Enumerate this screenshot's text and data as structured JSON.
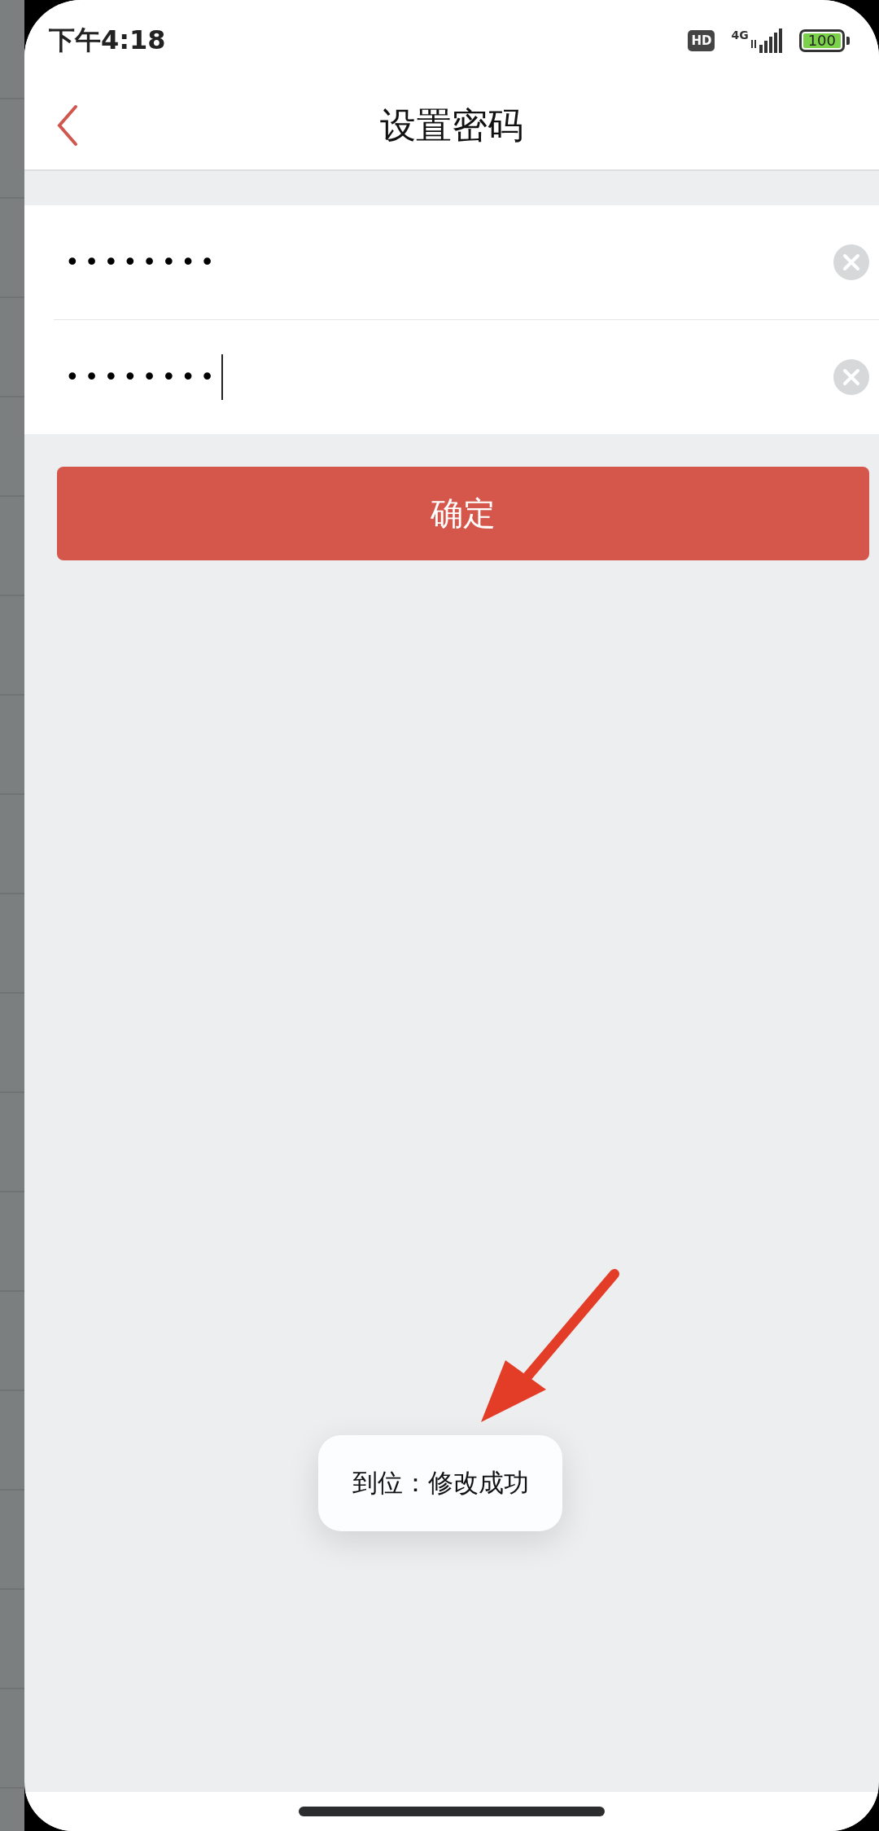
{
  "status_bar": {
    "time": "下午4:18",
    "hd": "HD",
    "network": "4G",
    "battery": "100"
  },
  "nav": {
    "title": "设置密码"
  },
  "fields": [
    {
      "value": "••••••••",
      "focused": false
    },
    {
      "value": "••••••••",
      "focused": true
    }
  ],
  "button": {
    "label": "确定"
  },
  "toast": {
    "text": "到位：修改成功"
  }
}
